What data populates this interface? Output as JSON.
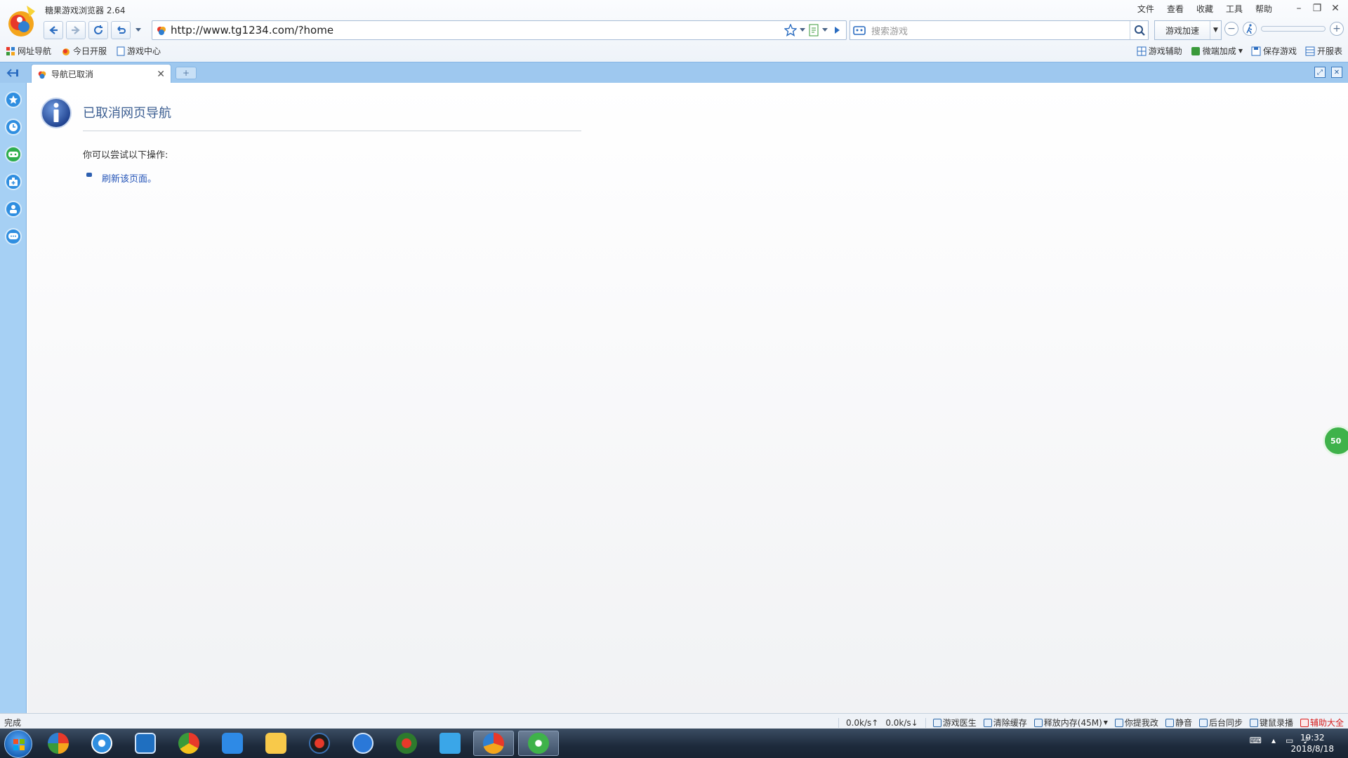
{
  "app": {
    "title": "糖果游戏浏览器 2.64"
  },
  "menu": [
    "文件",
    "查看",
    "收藏",
    "工具",
    "帮助"
  ],
  "address": {
    "url": "http://www.tg1234.com/?home"
  },
  "search": {
    "placeholder": "搜索游戏"
  },
  "accelerate": {
    "label": "游戏加速"
  },
  "bookmarks": [
    "网址导航",
    "今日开服",
    "游戏中心"
  ],
  "tools_right": [
    "游戏辅助",
    "微端加成",
    "保存游戏",
    "开服表"
  ],
  "tab": {
    "title": "导航已取消",
    "newtab": "+"
  },
  "page": {
    "heading": "已取消网页导航",
    "hint": "你可以尝试以下操作:",
    "link": "刷新该页面。",
    "badge": "50"
  },
  "status": {
    "text": "完成",
    "upload": "0.0k/s↑",
    "download": "0.0k/s↓",
    "items": [
      "游戏医生",
      "清除缓存",
      "释放内存(45M)",
      "你提我改",
      "静音",
      "后台同步",
      "键鼠录播",
      "辅助大全"
    ]
  },
  "taskbar": {
    "time": "19:32",
    "date": "2018/8/18"
  },
  "colors": {
    "accent": "#2f8ee0",
    "tabstrip": "#9ec8ef",
    "link": "#2454b8",
    "heading": "#3d5f92",
    "red": "#d81e1e"
  }
}
